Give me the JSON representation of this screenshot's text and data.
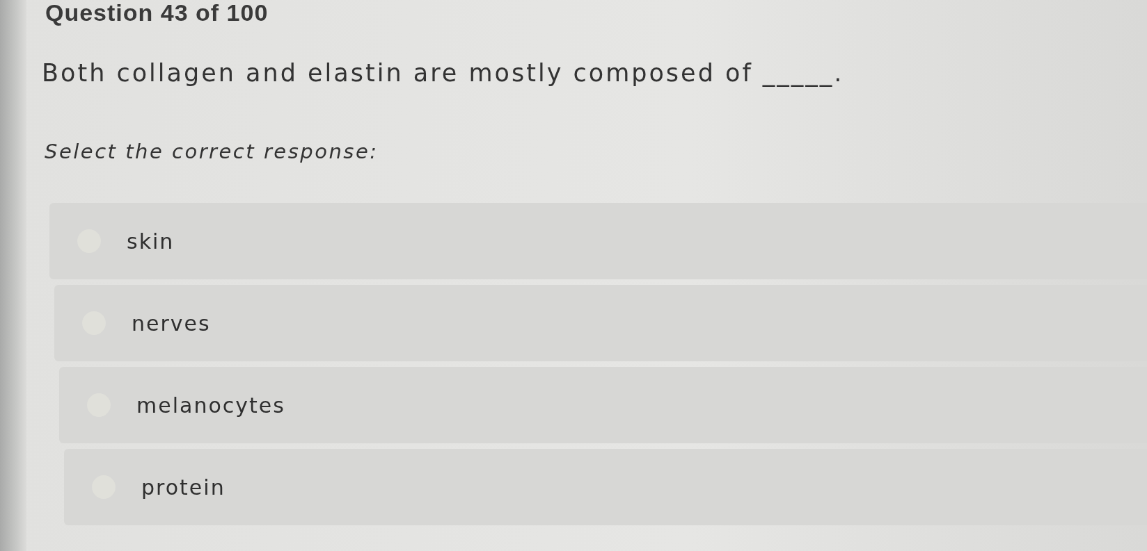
{
  "header": {
    "title": "Question 43 of 100"
  },
  "question": {
    "text": "Both collagen and elastin are mostly composed of _____.",
    "instruction": "Select the correct response:"
  },
  "options": [
    {
      "label": "skin",
      "selected": false
    },
    {
      "label": "nerves",
      "selected": false
    },
    {
      "label": "melanocytes",
      "selected": false
    },
    {
      "label": "protein",
      "selected": false
    }
  ]
}
